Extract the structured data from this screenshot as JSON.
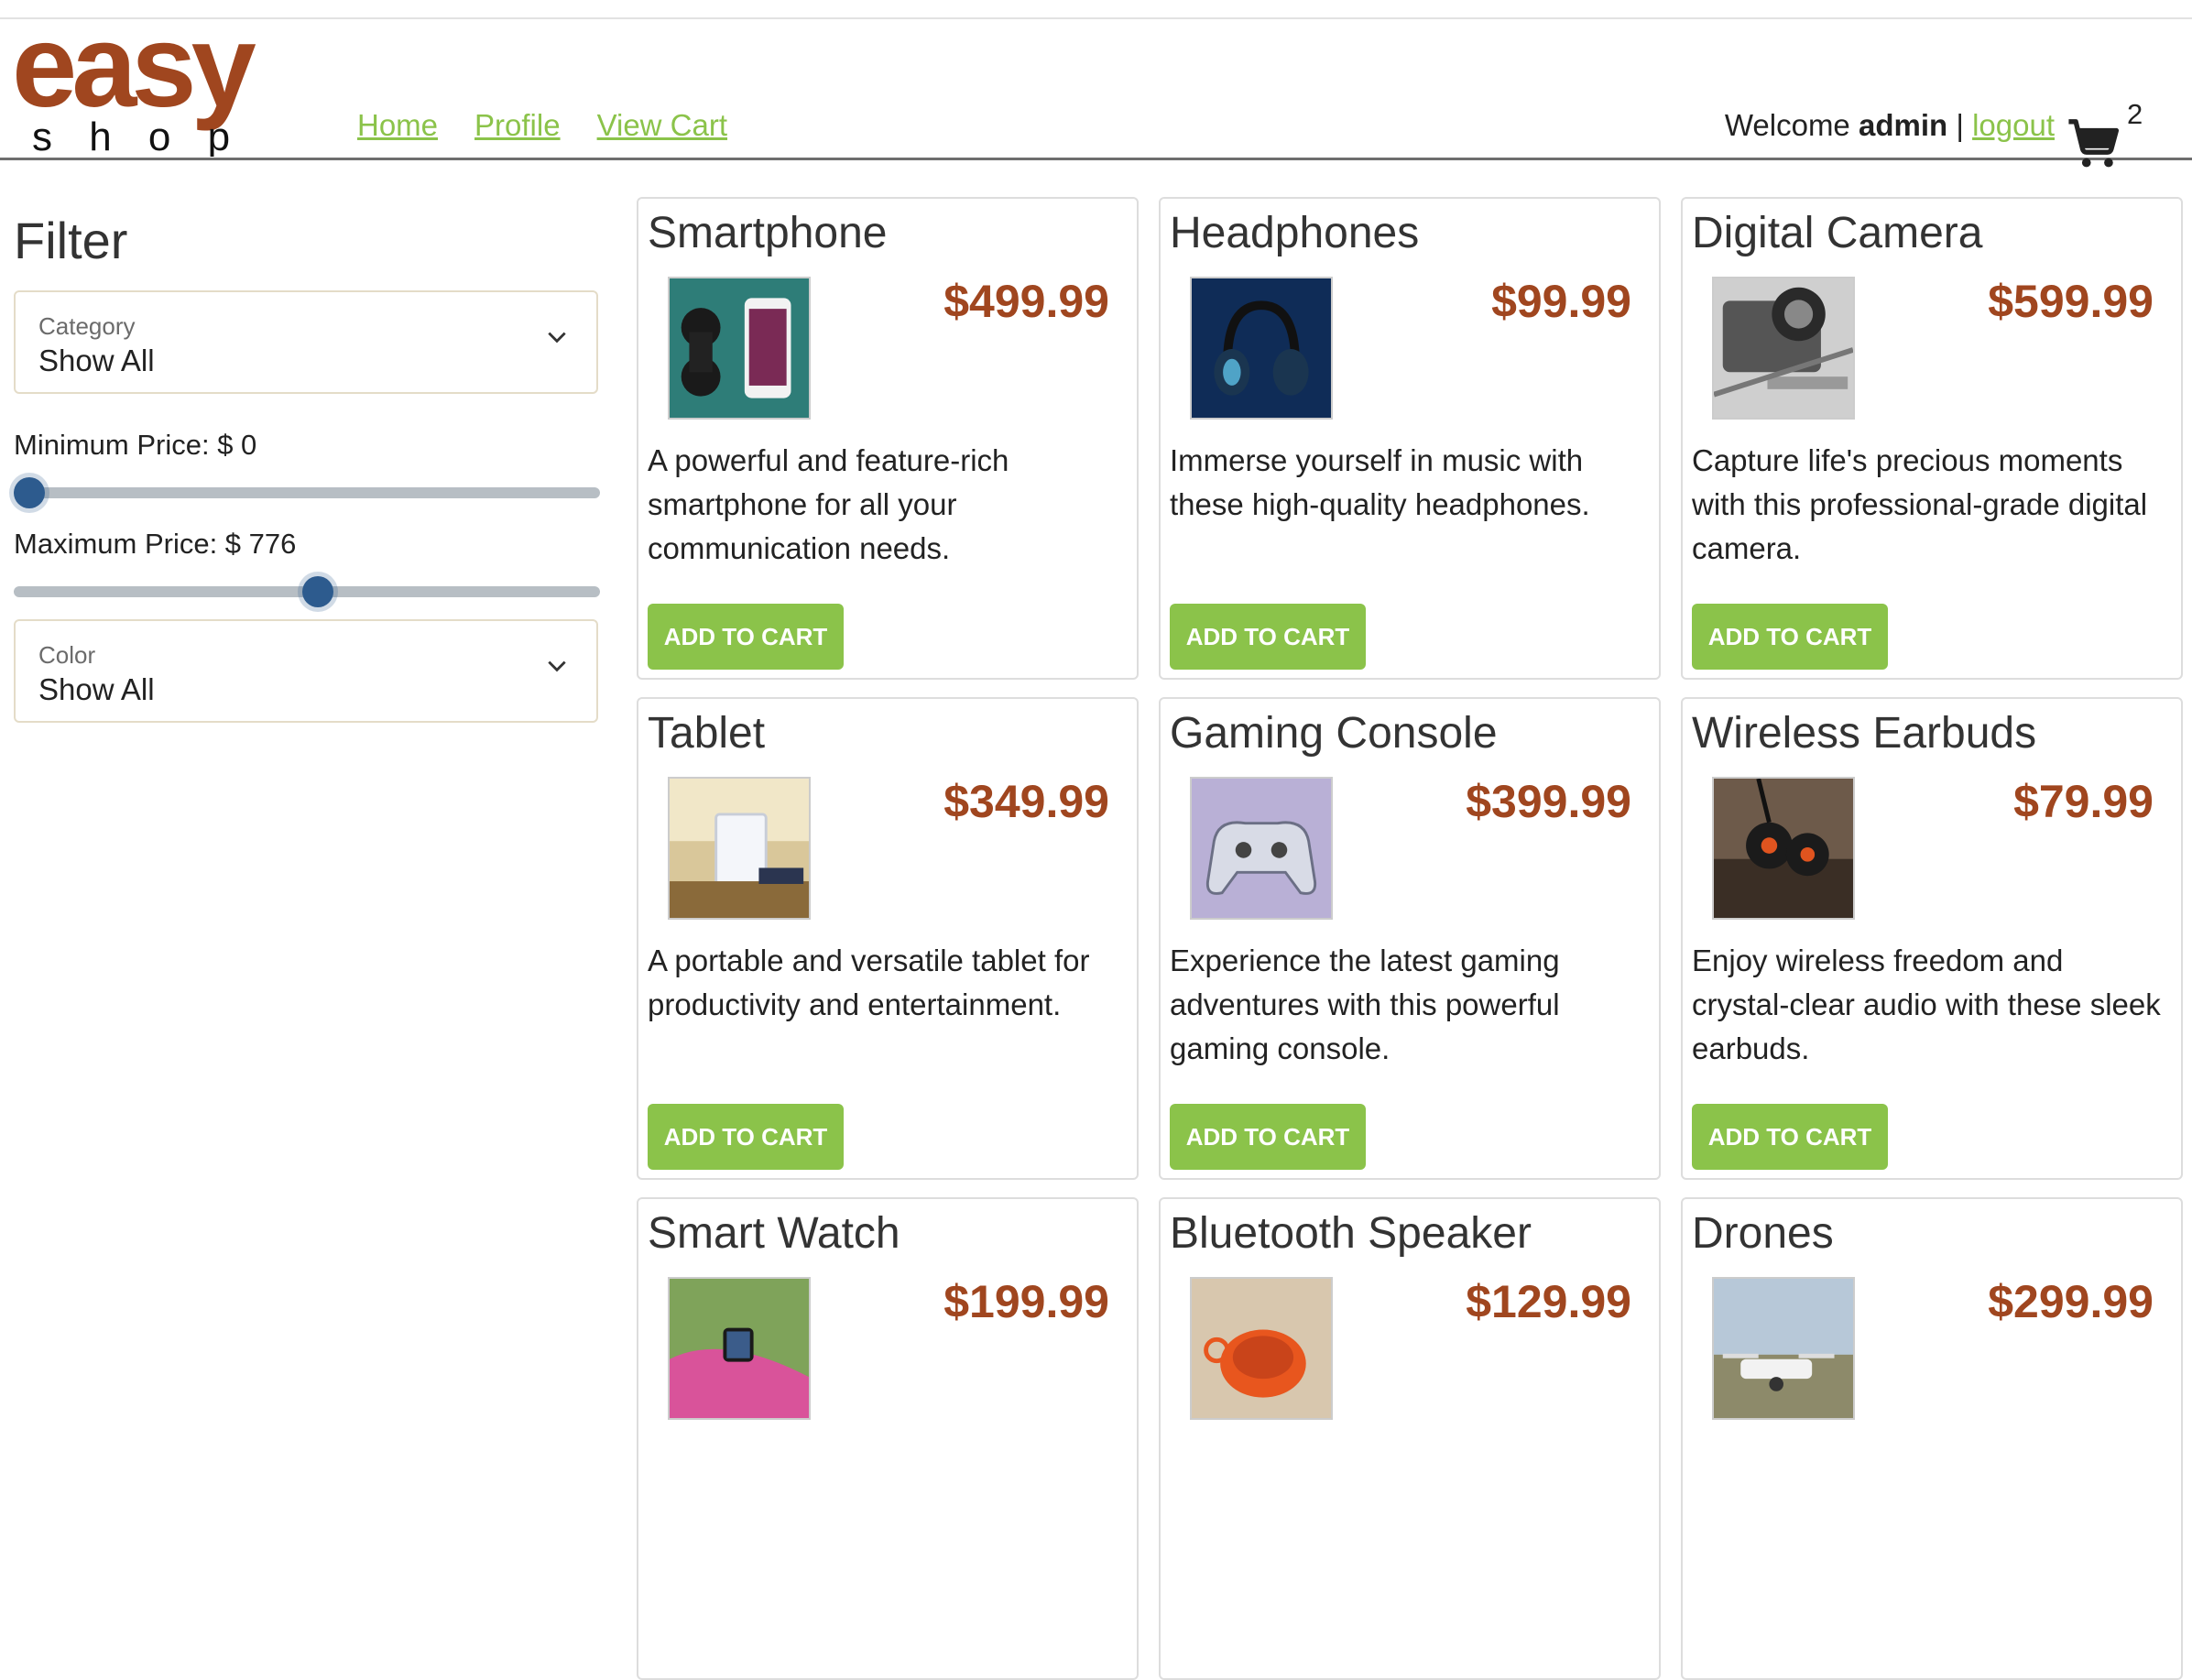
{
  "brand": {
    "line1": "easy",
    "line2": "s h o p",
    "color": "#a0461f"
  },
  "nav": [
    {
      "label": "Home"
    },
    {
      "label": "Profile"
    },
    {
      "label": "View Cart"
    }
  ],
  "user": {
    "welcome": "Welcome ",
    "name": "admin",
    "sep": " | ",
    "logout": "logout",
    "cart_count": "2",
    "cart_icon": "cart-icon"
  },
  "filter": {
    "title": "Filter",
    "category": {
      "label": "Category",
      "value": "Show All",
      "icon": "chevron-down-icon"
    },
    "min_price": {
      "label": "Minimum Price: $ 0",
      "value": 0,
      "fraction": 0.0
    },
    "max_price": {
      "label": "Maximum Price: $ 776",
      "value": 776,
      "fraction": 0.52
    },
    "color": {
      "label": "Color",
      "value": "Show All",
      "icon": "chevron-down-icon"
    }
  },
  "products": [
    {
      "name": "Smartphone",
      "price": "$499.99",
      "desc": "A powerful and feature-rich smartphone for all your communication needs.",
      "button": "ADD TO CART"
    },
    {
      "name": "Headphones",
      "price": "$99.99",
      "desc": "Immerse yourself in music with these high-quality headphones.",
      "button": "ADD TO CART"
    },
    {
      "name": "Digital Camera",
      "price": "$599.99",
      "desc": "Capture life's precious moments with this professional-grade digital camera.",
      "button": "ADD TO CART"
    },
    {
      "name": "Tablet",
      "price": "$349.99",
      "desc": "A portable and versatile tablet for productivity and entertainment.",
      "button": "ADD TO CART"
    },
    {
      "name": "Gaming Console",
      "price": "$399.99",
      "desc": "Experience the latest gaming adventures with this powerful gaming console.",
      "button": "ADD TO CART"
    },
    {
      "name": "Wireless Earbuds",
      "price": "$79.99",
      "desc": "Enjoy wireless freedom and crystal-clear audio with these sleek earbuds.",
      "button": "ADD TO CART"
    },
    {
      "name": "Smart Watch",
      "price": "$199.99",
      "desc": "",
      "button": ""
    },
    {
      "name": "Bluetooth Speaker",
      "price": "$129.99",
      "desc": "",
      "button": ""
    },
    {
      "name": "Drones",
      "price": "$299.99",
      "desc": "",
      "button": ""
    }
  ],
  "colors": {
    "accent": "#8bc34a",
    "price": "#a0461f",
    "slider_thumb": "#2d5b8e"
  }
}
